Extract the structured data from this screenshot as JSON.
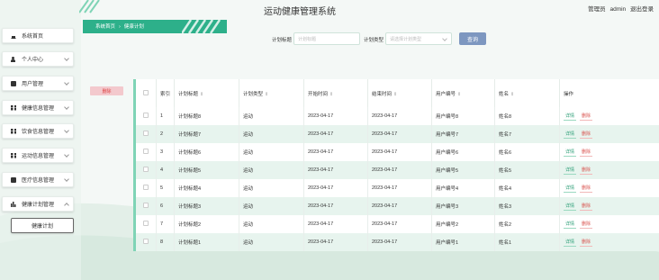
{
  "header": {
    "title": "运动健康管理系统",
    "user_role": "管理员",
    "username": "admin",
    "logout_label": "退出登录"
  },
  "breadcrumb": {
    "home": "系统首页",
    "separator": "›",
    "current": "健康计划"
  },
  "sidebar": {
    "items": [
      {
        "label": "系统首页",
        "icon": "home-icon"
      },
      {
        "label": "个人中心",
        "icon": "user-icon"
      },
      {
        "label": "用户管理",
        "icon": "card-icon"
      },
      {
        "label": "健康信息管理",
        "icon": "grid-icon"
      },
      {
        "label": "饮食信息管理",
        "icon": "grid-icon"
      },
      {
        "label": "运动信息管理",
        "icon": "grid-icon"
      },
      {
        "label": "医疗信息管理",
        "icon": "check-icon"
      },
      {
        "label": "健康计划管理",
        "icon": "bar-chart-icon"
      }
    ],
    "sub_item": "健康计划"
  },
  "search": {
    "title_label": "计划标题",
    "title_placeholder": "计划标题",
    "type_label": "计划类型",
    "type_placeholder": "请选择计划类型",
    "button_label": "查询"
  },
  "delete_button": "删除",
  "table": {
    "headers": [
      "",
      "索引",
      "计划标题",
      "计划类型",
      "开始时间",
      "结束时间",
      "用户编号",
      "姓名",
      "操作"
    ],
    "detail_label": "详情",
    "delete_label": "删除",
    "rows": [
      {
        "index": "1",
        "title": "计划标题8",
        "type": "运动",
        "start": "2023-04-17",
        "end": "2023-04-17",
        "user_no": "用户编号8",
        "name": "姓名8"
      },
      {
        "index": "2",
        "title": "计划标题7",
        "type": "运动",
        "start": "2023-04-17",
        "end": "2023-04-17",
        "user_no": "用户编号7",
        "name": "姓名7"
      },
      {
        "index": "3",
        "title": "计划标题6",
        "type": "运动",
        "start": "2023-04-17",
        "end": "2023-04-17",
        "user_no": "用户编号6",
        "name": "姓名6"
      },
      {
        "index": "4",
        "title": "计划标题5",
        "type": "运动",
        "start": "2023-04-17",
        "end": "2023-04-17",
        "user_no": "用户编号5",
        "name": "姓名5"
      },
      {
        "index": "5",
        "title": "计划标题4",
        "type": "运动",
        "start": "2023-04-17",
        "end": "2023-04-17",
        "user_no": "用户编号4",
        "name": "姓名4"
      },
      {
        "index": "6",
        "title": "计划标题3",
        "type": "运动",
        "start": "2023-04-17",
        "end": "2023-04-17",
        "user_no": "用户编号3",
        "name": "姓名3"
      },
      {
        "index": "7",
        "title": "计划标题2",
        "type": "运动",
        "start": "2023-04-17",
        "end": "2023-04-17",
        "user_no": "用户编号2",
        "name": "姓名2"
      },
      {
        "index": "8",
        "title": "计划标题1",
        "type": "运动",
        "start": "2023-04-17",
        "end": "2023-04-17",
        "user_no": "用户编号1",
        "name": "姓名1"
      }
    ]
  },
  "colors": {
    "accent": "#2db08a",
    "search_button": "#7d97c0",
    "delete_pink": "#f3c9cd",
    "row_alt": "#e7f4ee"
  }
}
